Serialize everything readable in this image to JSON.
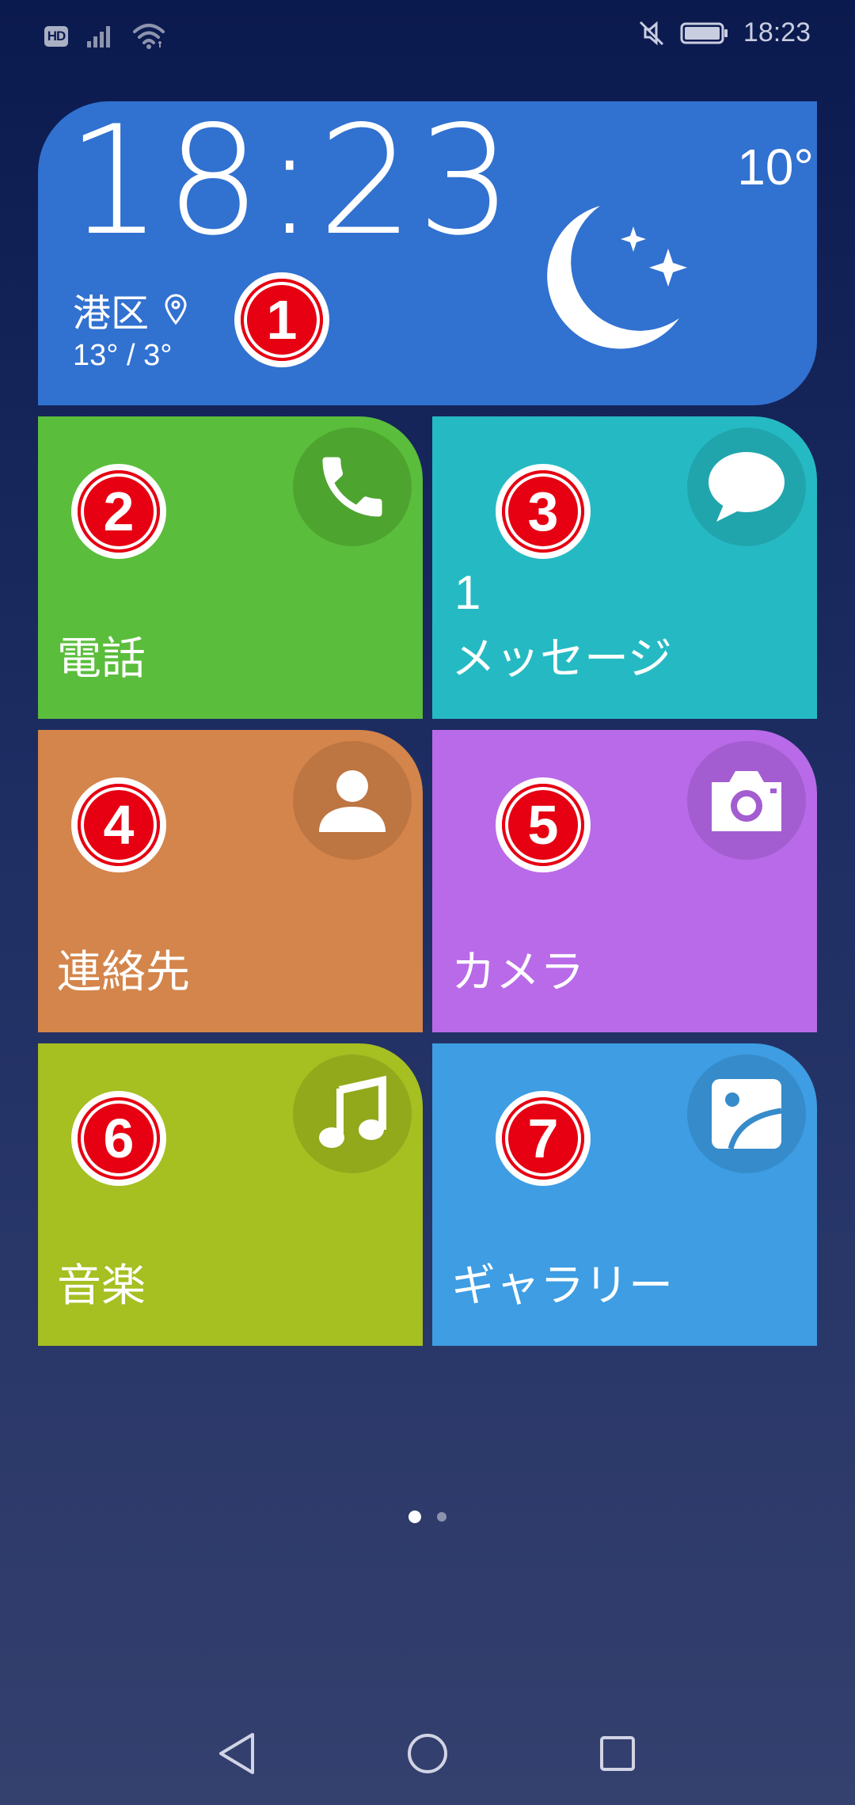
{
  "status_bar": {
    "hd_badge": "HD",
    "time": "18:23"
  },
  "clock_widget": {
    "time": "18:23",
    "location": "港区",
    "temp_range": "13° / 3°",
    "temp_now": "10°",
    "badge_number": "1"
  },
  "tiles": [
    {
      "label": "電話",
      "badge_number": "2",
      "color": "#5bbd3c"
    },
    {
      "label": "メッセージ",
      "count": "1",
      "badge_number": "3",
      "color": "#25bac3"
    },
    {
      "label": "連絡先",
      "badge_number": "4",
      "color": "#d4854b"
    },
    {
      "label": "カメラ",
      "badge_number": "5",
      "color": "#b96ae8"
    },
    {
      "label": "音楽",
      "badge_number": "6",
      "color": "#a6bf21"
    },
    {
      "label": "ギャラリー",
      "badge_number": "7",
      "color": "#3e9de3"
    }
  ],
  "page_indicator": {
    "pages": 2,
    "current": 1
  },
  "badge_color": "#e60012"
}
